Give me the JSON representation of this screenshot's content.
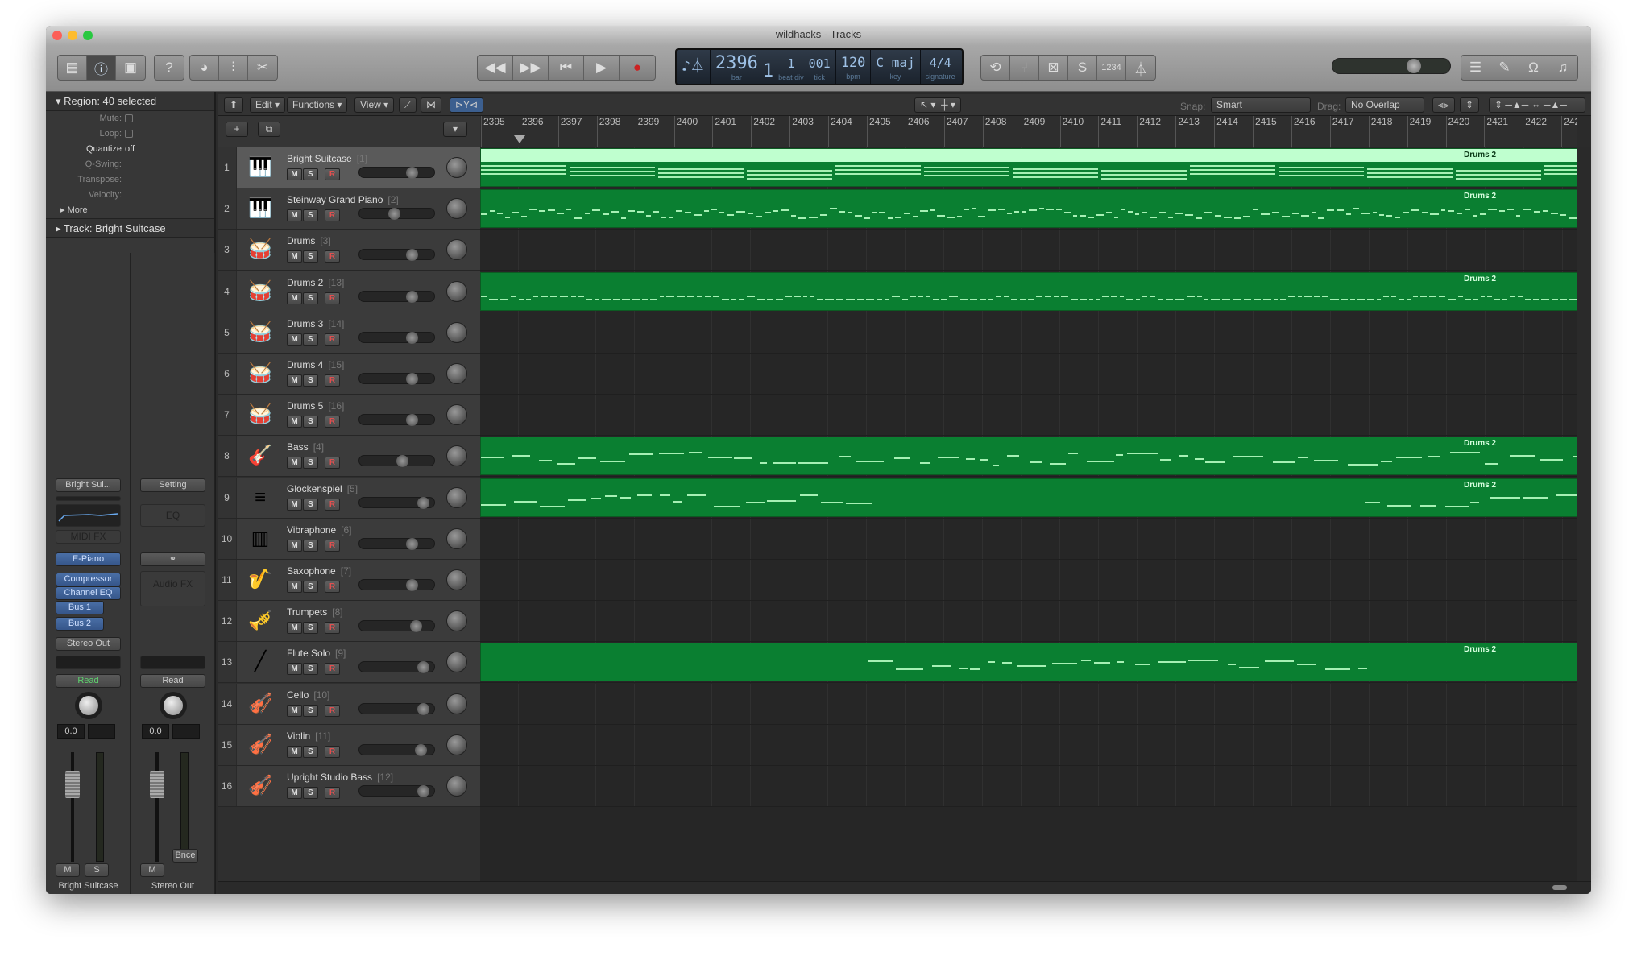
{
  "window": {
    "title": "wildhacks - Tracks"
  },
  "toolbar": {
    "left_icons": [
      "library-icon",
      "info-icon",
      "toolbar-icon",
      "help-icon",
      "smart-controls-icon",
      "mixer-icon",
      "editors-icon"
    ],
    "transport": [
      "rewind-icon",
      "fast-forward-icon",
      "go-to-start-icon",
      "play-icon",
      "record-icon"
    ],
    "lcd": {
      "bar": "2396",
      "beat": "1",
      "div": "1",
      "tick": "001",
      "bpm": "120",
      "key": "C maj",
      "signature": "4/4",
      "labels": {
        "bar": "bar",
        "beat_div": "beat div",
        "tick": "tick",
        "bpm": "bpm",
        "key": "key",
        "signature": "signature"
      }
    },
    "right_icons": [
      "cycle-icon",
      "tuner-icon",
      "replace-icon",
      "solo-icon",
      "count-in-icon",
      "metronome-icon"
    ],
    "count_in_label": "1234",
    "solo_label": "S",
    "master_volume": 0.72,
    "browser_icons": [
      "list-editors-icon",
      "notepad-icon",
      "loops-icon",
      "media-browser-icon"
    ]
  },
  "inspector": {
    "region_header": "Region: 40 selected",
    "rows": [
      {
        "k": "Mute:",
        "type": "check"
      },
      {
        "k": "Loop:",
        "type": "check"
      },
      {
        "k": "Quantize",
        "v": "off"
      },
      {
        "k": "Q-Swing:",
        "v": ""
      },
      {
        "k": "Transpose:",
        "v": ""
      },
      {
        "k": "Velocity:",
        "v": ""
      }
    ],
    "more": "More",
    "track_header": "Track:  Bright Suitcase",
    "strip1": {
      "setting": "Bright Sui...",
      "midi_fx": "MIDI FX",
      "instrument": "E-Piano",
      "fx": [
        "Compressor",
        "Channel EQ"
      ],
      "sends": [
        "Bus 1",
        "Bus 2"
      ],
      "output": "Stereo Out",
      "automation": "Read",
      "volume": "0.0",
      "mute": "M",
      "solo": "S",
      "name": "Bright Suitcase"
    },
    "strip2": {
      "setting": "Setting",
      "eq": "EQ",
      "audio_fx": "Audio FX",
      "automation": "Read",
      "volume": "0.0",
      "bounce": "Bnce",
      "mute": "M",
      "name": "Stereo Out"
    }
  },
  "local_toolbar": {
    "edit": "Edit",
    "functions": "Functions",
    "view": "View",
    "snap_label": "Snap:",
    "snap": "Smart",
    "drag_label": "Drag:",
    "drag": "No Overlap"
  },
  "ruler": {
    "bars": [
      "2395",
      "2396",
      "2397",
      "2398",
      "2399",
      "2400",
      "2401",
      "2402",
      "2403",
      "2404",
      "2405",
      "2406",
      "2407",
      "2408",
      "2409",
      "2410",
      "2411",
      "2412",
      "2413",
      "2414",
      "2415",
      "2416",
      "2417",
      "2418",
      "2419",
      "2420",
      "2421",
      "2422",
      "242"
    ],
    "playhead_bar": 2396
  },
  "tracks": [
    {
      "n": "1",
      "name": "Bright Suitcase",
      "idx": "[1]",
      "icon": "electric-piano-icon",
      "vol": 0.72,
      "selected": true,
      "region": "Drums 2"
    },
    {
      "n": "2",
      "name": "Steinway Grand Piano",
      "idx": "[2]",
      "icon": "grand-piano-icon",
      "vol": 0.45,
      "region": "Drums 2"
    },
    {
      "n": "3",
      "name": "Drums",
      "idx": "[3]",
      "icon": "drum-kit-icon",
      "vol": 0.72
    },
    {
      "n": "4",
      "name": "Drums 2",
      "idx": "[13]",
      "icon": "drum-kit-icon",
      "vol": 0.72,
      "region": "Drums 2"
    },
    {
      "n": "5",
      "name": "Drums 3",
      "idx": "[14]",
      "icon": "drum-kit-icon",
      "vol": 0.72
    },
    {
      "n": "6",
      "name": "Drums 4",
      "idx": "[15]",
      "icon": "drum-kit-icon",
      "vol": 0.72
    },
    {
      "n": "7",
      "name": "Drums 5",
      "idx": "[16]",
      "icon": "drum-kit-icon",
      "vol": 0.72
    },
    {
      "n": "8",
      "name": "Bass",
      "idx": "[4]",
      "icon": "bass-guitar-icon",
      "vol": 0.58,
      "region": "Drums 2"
    },
    {
      "n": "9",
      "name": "Glockenspiel",
      "idx": "[5]",
      "icon": "glockenspiel-icon",
      "vol": 0.9,
      "region": "Drums 2"
    },
    {
      "n": "10",
      "name": "Vibraphone",
      "idx": "[6]",
      "icon": "vibraphone-icon",
      "vol": 0.72
    },
    {
      "n": "11",
      "name": "Saxophone",
      "idx": "[7]",
      "icon": "saxophone-icon",
      "vol": 0.72
    },
    {
      "n": "12",
      "name": "Trumpets",
      "idx": "[8]",
      "icon": "trumpet-icon",
      "vol": 0.79
    },
    {
      "n": "13",
      "name": "Flute Solo",
      "idx": "[9]",
      "icon": "flute-icon",
      "vol": 0.9,
      "region": "Drums 2"
    },
    {
      "n": "14",
      "name": "Cello",
      "idx": "[10]",
      "icon": "cello-icon",
      "vol": 0.9
    },
    {
      "n": "15",
      "name": "Violin",
      "idx": "[11]",
      "icon": "violin-icon",
      "vol": 0.86
    },
    {
      "n": "16",
      "name": "Upright Studio Bass",
      "idx": "[12]",
      "icon": "upright-bass-icon",
      "vol": 0.9
    }
  ],
  "track_buttons": {
    "mute": "M",
    "solo": "S",
    "record": "R"
  },
  "colors": {
    "region": "#0a7f31",
    "region_selected": "#bfffcf",
    "record": "#e05050",
    "blue_slot": "#4a6fa6",
    "read": "#5fd46f"
  }
}
